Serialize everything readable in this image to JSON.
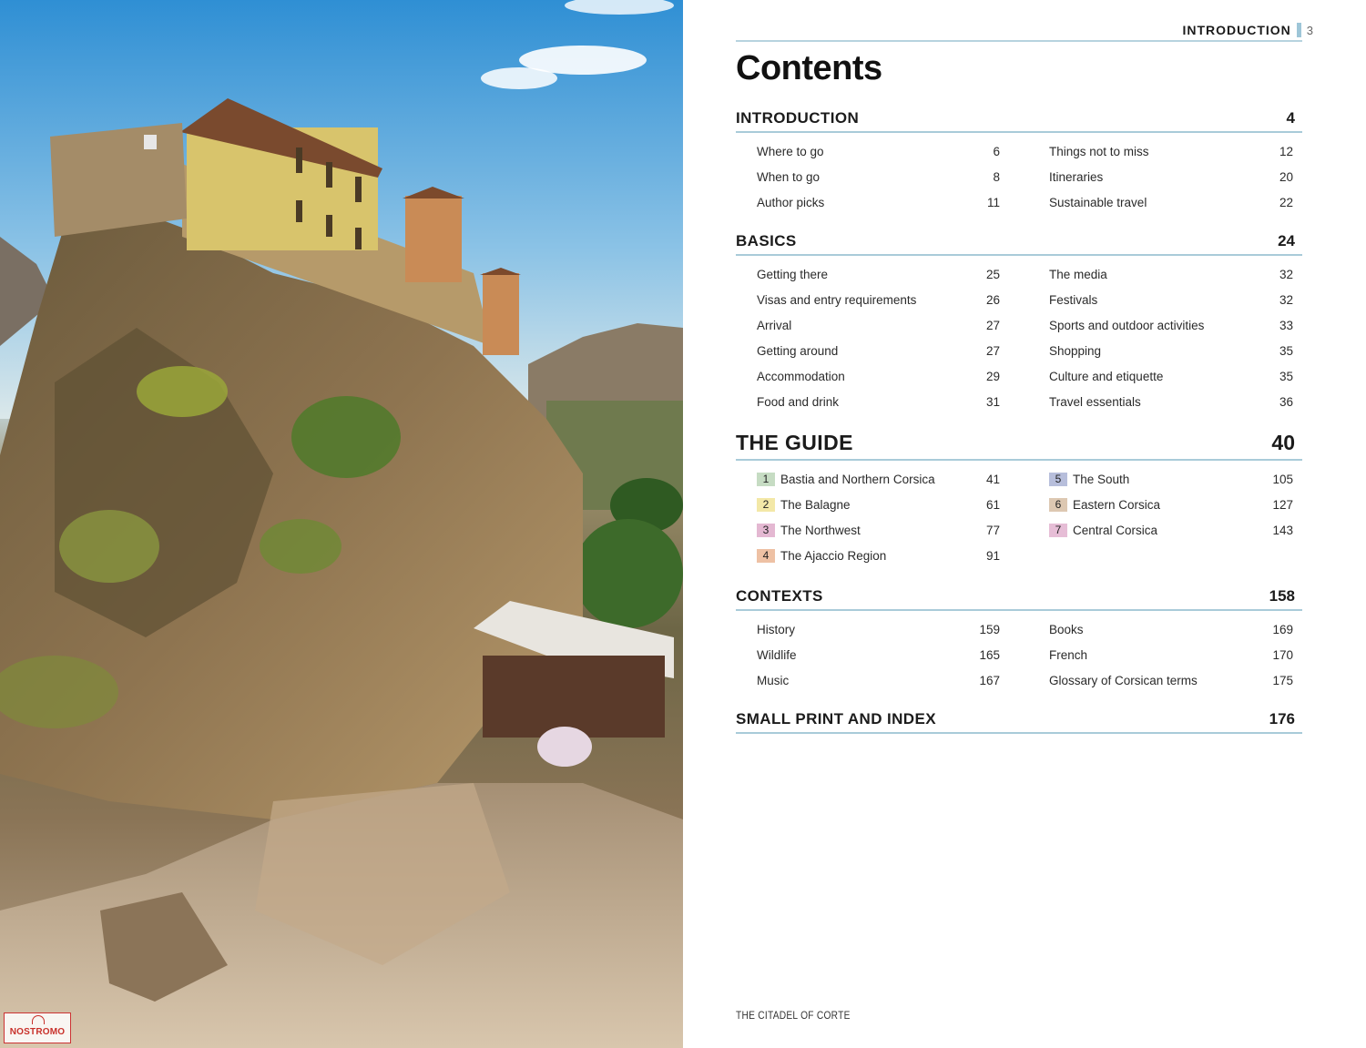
{
  "running_head": {
    "label": "INTRODUCTION",
    "page": "3"
  },
  "title": "Contents",
  "sections": {
    "introduction": {
      "name": "INTRODUCTION",
      "page": "4",
      "left": [
        {
          "title": "Where to go",
          "page": "6"
        },
        {
          "title": "When to go",
          "page": "8"
        },
        {
          "title": "Author picks",
          "page": "11"
        }
      ],
      "right": [
        {
          "title": "Things not to miss",
          "page": "12"
        },
        {
          "title": "Itineraries",
          "page": "20"
        },
        {
          "title": "Sustainable travel",
          "page": "22"
        }
      ]
    },
    "basics": {
      "name": "BASICS",
      "page": "24",
      "left": [
        {
          "title": "Getting there",
          "page": "25"
        },
        {
          "title": "Visas and entry requirements",
          "page": "26"
        },
        {
          "title": "Arrival",
          "page": "27"
        },
        {
          "title": "Getting around",
          "page": "27"
        },
        {
          "title": "Accommodation",
          "page": "29"
        },
        {
          "title": "Food and drink",
          "page": "31"
        }
      ],
      "right": [
        {
          "title": "The media",
          "page": "32"
        },
        {
          "title": "Festivals",
          "page": "32"
        },
        {
          "title": "Sports and outdoor activities",
          "page": "33"
        },
        {
          "title": "Shopping",
          "page": "35"
        },
        {
          "title": "Culture and etiquette",
          "page": "35"
        },
        {
          "title": "Travel essentials",
          "page": "36"
        }
      ]
    },
    "guide": {
      "name": "THE GUIDE",
      "page": "40",
      "left": [
        {
          "num": "1",
          "title": "Bastia and Northern Corsica",
          "page": "41",
          "color": "#c6dcc3"
        },
        {
          "num": "2",
          "title": "The Balagne",
          "page": "61",
          "color": "#f3e8a7"
        },
        {
          "num": "3",
          "title": "The Northwest",
          "page": "77",
          "color": "#e4b8d2"
        },
        {
          "num": "4",
          "title": "The Ajaccio Region",
          "page": "91",
          "color": "#eec1a4"
        }
      ],
      "right": [
        {
          "num": "5",
          "title": "The South",
          "page": "105",
          "color": "#b7bedb"
        },
        {
          "num": "6",
          "title": "Eastern Corsica",
          "page": "127",
          "color": "#ddc8b2"
        },
        {
          "num": "7",
          "title": "Central Corsica",
          "page": "143",
          "color": "#e6bdd6"
        }
      ]
    },
    "contexts": {
      "name": "CONTEXTS",
      "page": "158",
      "left": [
        {
          "title": "History",
          "page": "159"
        },
        {
          "title": "Wildlife",
          "page": "165"
        },
        {
          "title": "Music",
          "page": "167"
        }
      ],
      "right": [
        {
          "title": "Books",
          "page": "169"
        },
        {
          "title": "French",
          "page": "170"
        },
        {
          "title": "Glossary of Corsican terms",
          "page": "175"
        }
      ]
    },
    "small_print": {
      "name": "SMALL PRINT AND INDEX",
      "page": "176"
    }
  },
  "caption": "THE CITADEL OF CORTE",
  "watermark": "NOSTROMO"
}
